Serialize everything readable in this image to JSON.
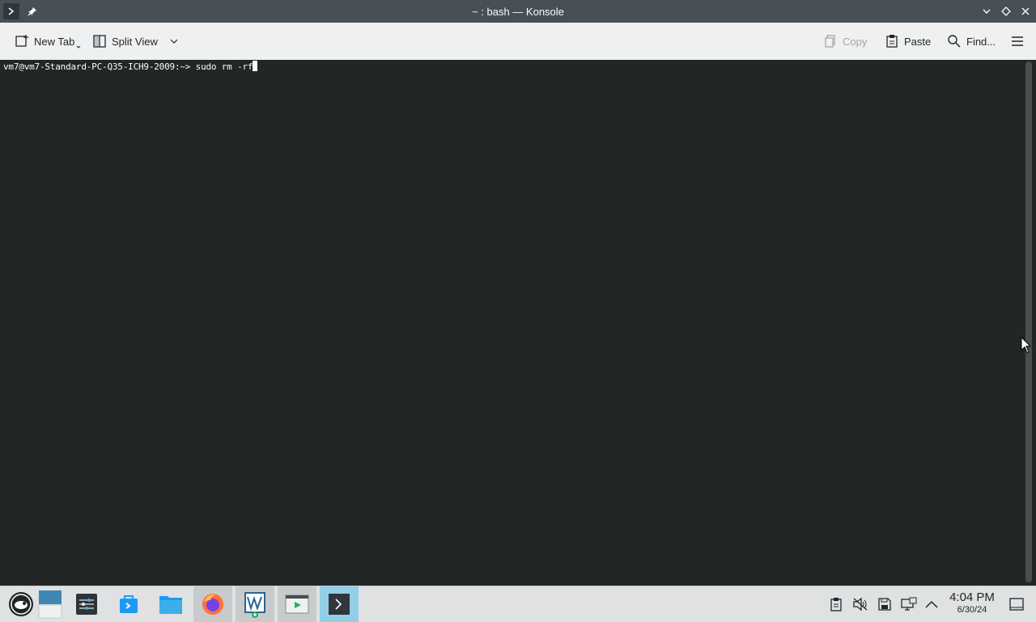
{
  "window": {
    "title": "~ : bash — Konsole"
  },
  "toolbar": {
    "new_tab_label": "New Tab",
    "split_view_label": "Split View",
    "copy_label": "Copy",
    "paste_label": "Paste",
    "find_label": "Find..."
  },
  "terminal": {
    "prompt": "vm7@vm7-Standard-PC-Q35-ICH9-2009:~> ",
    "command": "sudo rm -rf"
  },
  "taskbar": {
    "apps": [
      {
        "name": "application-launcher",
        "icon": "opensuse-icon"
      },
      {
        "name": "desktop-pager",
        "icon": "pager-icon"
      },
      {
        "name": "system-settings",
        "icon": "settings-icon"
      },
      {
        "name": "discover",
        "icon": "discover-icon"
      },
      {
        "name": "dolphin",
        "icon": "folder-icon"
      },
      {
        "name": "firefox",
        "icon": "firefox-icon"
      },
      {
        "name": "writer",
        "icon": "writer-icon"
      },
      {
        "name": "media-player",
        "icon": "video-icon"
      },
      {
        "name": "konsole",
        "icon": "terminal-icon"
      }
    ],
    "clock": {
      "time": "4:04 PM",
      "date": "6/30/24"
    }
  },
  "colors": {
    "titlebar": "#475057",
    "terminal_bg": "#232627",
    "terminal_fg": "#fcfcfc",
    "taskbar": "#dfe1e3",
    "active_task": "#93cee9"
  }
}
